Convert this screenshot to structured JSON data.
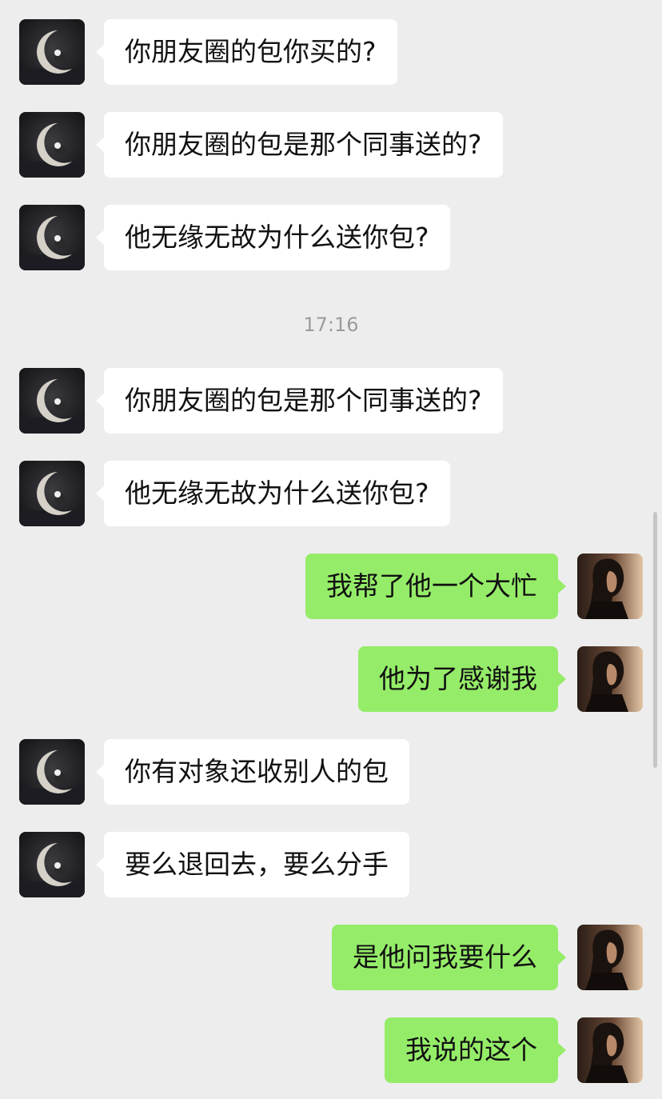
{
  "timestamp": "17:16",
  "messages": [
    {
      "side": "in",
      "text": "你朋友圈的包你买的?"
    },
    {
      "side": "in",
      "text": "你朋友圈的包是那个同事送的?"
    },
    {
      "side": "in",
      "text": "他无缘无故为什么送你包?"
    },
    {
      "side": "in",
      "text": "你朋友圈的包是那个同事送的?"
    },
    {
      "side": "in",
      "text": "他无缘无故为什么送你包?"
    },
    {
      "side": "out",
      "text": "我帮了他一个大忙"
    },
    {
      "side": "out",
      "text": "他为了感谢我"
    },
    {
      "side": "in",
      "text": "你有对象还收别人的包"
    },
    {
      "side": "in",
      "text": "要么退回去，要么分手"
    },
    {
      "side": "out",
      "text": "是他问我要什么"
    },
    {
      "side": "out",
      "text": "我说的这个"
    }
  ],
  "colors": {
    "background": "#ededed",
    "incoming_bubble": "#ffffff",
    "outgoing_bubble": "#95ec69",
    "timestamp_text": "#9b9b9b"
  },
  "icons": {
    "contact_avatar": "moon-avatar-icon",
    "self_avatar": "woman-portrait-avatar"
  }
}
